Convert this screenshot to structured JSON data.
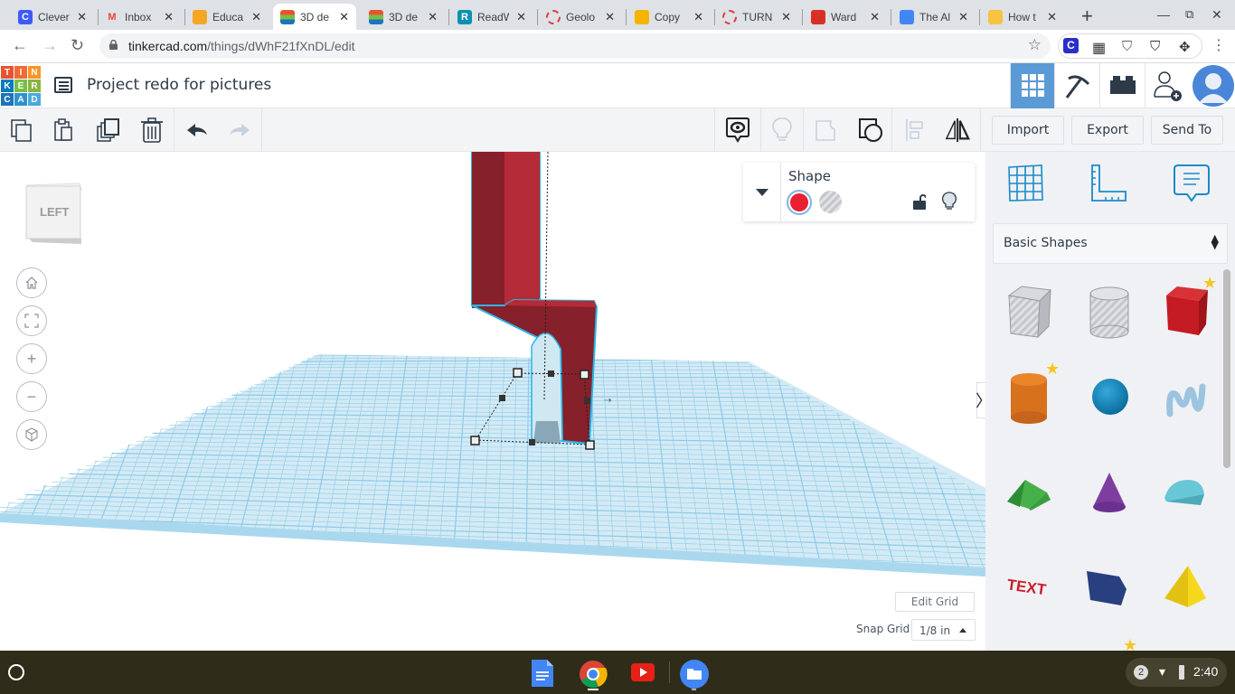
{
  "browser": {
    "tabs": [
      {
        "title": "Clever",
        "icon": "clever-icon",
        "color": "#3d5afe",
        "glyph": "C"
      },
      {
        "title": "Inbox",
        "icon": "gmail-icon",
        "color": "#ffffff",
        "glyph": "M"
      },
      {
        "title": "Educa",
        "icon": "edpuzzle-icon",
        "color": "#f5a623",
        "glyph": ""
      },
      {
        "title": "3D de",
        "icon": "tinkercad-icon",
        "color": "#e5532d",
        "glyph": "",
        "active": true
      },
      {
        "title": "3D de",
        "icon": "tinkercad-icon",
        "color": "#e5532d",
        "glyph": ""
      },
      {
        "title": "ReadW",
        "icon": "readworks-icon",
        "color": "#0e8fb0",
        "glyph": "R"
      },
      {
        "title": "Geolo",
        "icon": "loading-ring-icon",
        "color": "#e03b3b",
        "glyph": ""
      },
      {
        "title": "Copy",
        "icon": "slides-icon",
        "color": "#f4b400",
        "glyph": ""
      },
      {
        "title": "TURN",
        "icon": "loading-ring-icon",
        "color": "#e03b3b",
        "glyph": ""
      },
      {
        "title": "Ward",
        "icon": "ward-icon",
        "color": "#d93025",
        "glyph": ""
      },
      {
        "title": "The Al",
        "icon": "docs-icon",
        "color": "#4285f4",
        "glyph": ""
      },
      {
        "title": "How t",
        "icon": "howto-icon",
        "color": "#f6c342",
        "glyph": ""
      }
    ],
    "url_host": "tinkercad.com",
    "url_path": "/things/dWhF21fXnDL/edit"
  },
  "app": {
    "logo_letters": [
      "T",
      "I",
      "N",
      "K",
      "E",
      "R",
      "C",
      "A",
      "D"
    ],
    "logo_colors": [
      "#e8532f",
      "#f26a36",
      "#f7952a",
      "#0a7bbd",
      "#77c043",
      "#8ab33f",
      "#1b75bb",
      "#2f91ce",
      "#4aa9dd"
    ],
    "project_title": "Project redo for pictures"
  },
  "toolbar": {
    "import_label": "Import",
    "export_label": "Export",
    "send_to_label": "Send To"
  },
  "viewport": {
    "viewcube_label": "LEFT",
    "edit_grid_label": "Edit Grid",
    "snap_grid_label": "Snap Grid",
    "snap_grid_value": "1/8 in"
  },
  "inspector": {
    "title": "Shape",
    "solid_color": "#e8202f"
  },
  "shapes_panel": {
    "category": "Basic Shapes",
    "shapes": [
      {
        "name": "Box Hole",
        "starred": false
      },
      {
        "name": "Cylinder Hole",
        "starred": false
      },
      {
        "name": "Box",
        "starred": true
      },
      {
        "name": "Cylinder",
        "starred": true
      },
      {
        "name": "Sphere",
        "starred": false
      },
      {
        "name": "Scribble",
        "starred": false
      },
      {
        "name": "Roof",
        "starred": false
      },
      {
        "name": "Cone",
        "starred": false
      },
      {
        "name": "Round Roof",
        "starred": false
      },
      {
        "name": "Text",
        "starred": false
      },
      {
        "name": "Polygon",
        "starred": false
      },
      {
        "name": "Pyramid",
        "starred": false
      }
    ]
  },
  "shelf": {
    "notifications": "2",
    "time": "2:40"
  }
}
